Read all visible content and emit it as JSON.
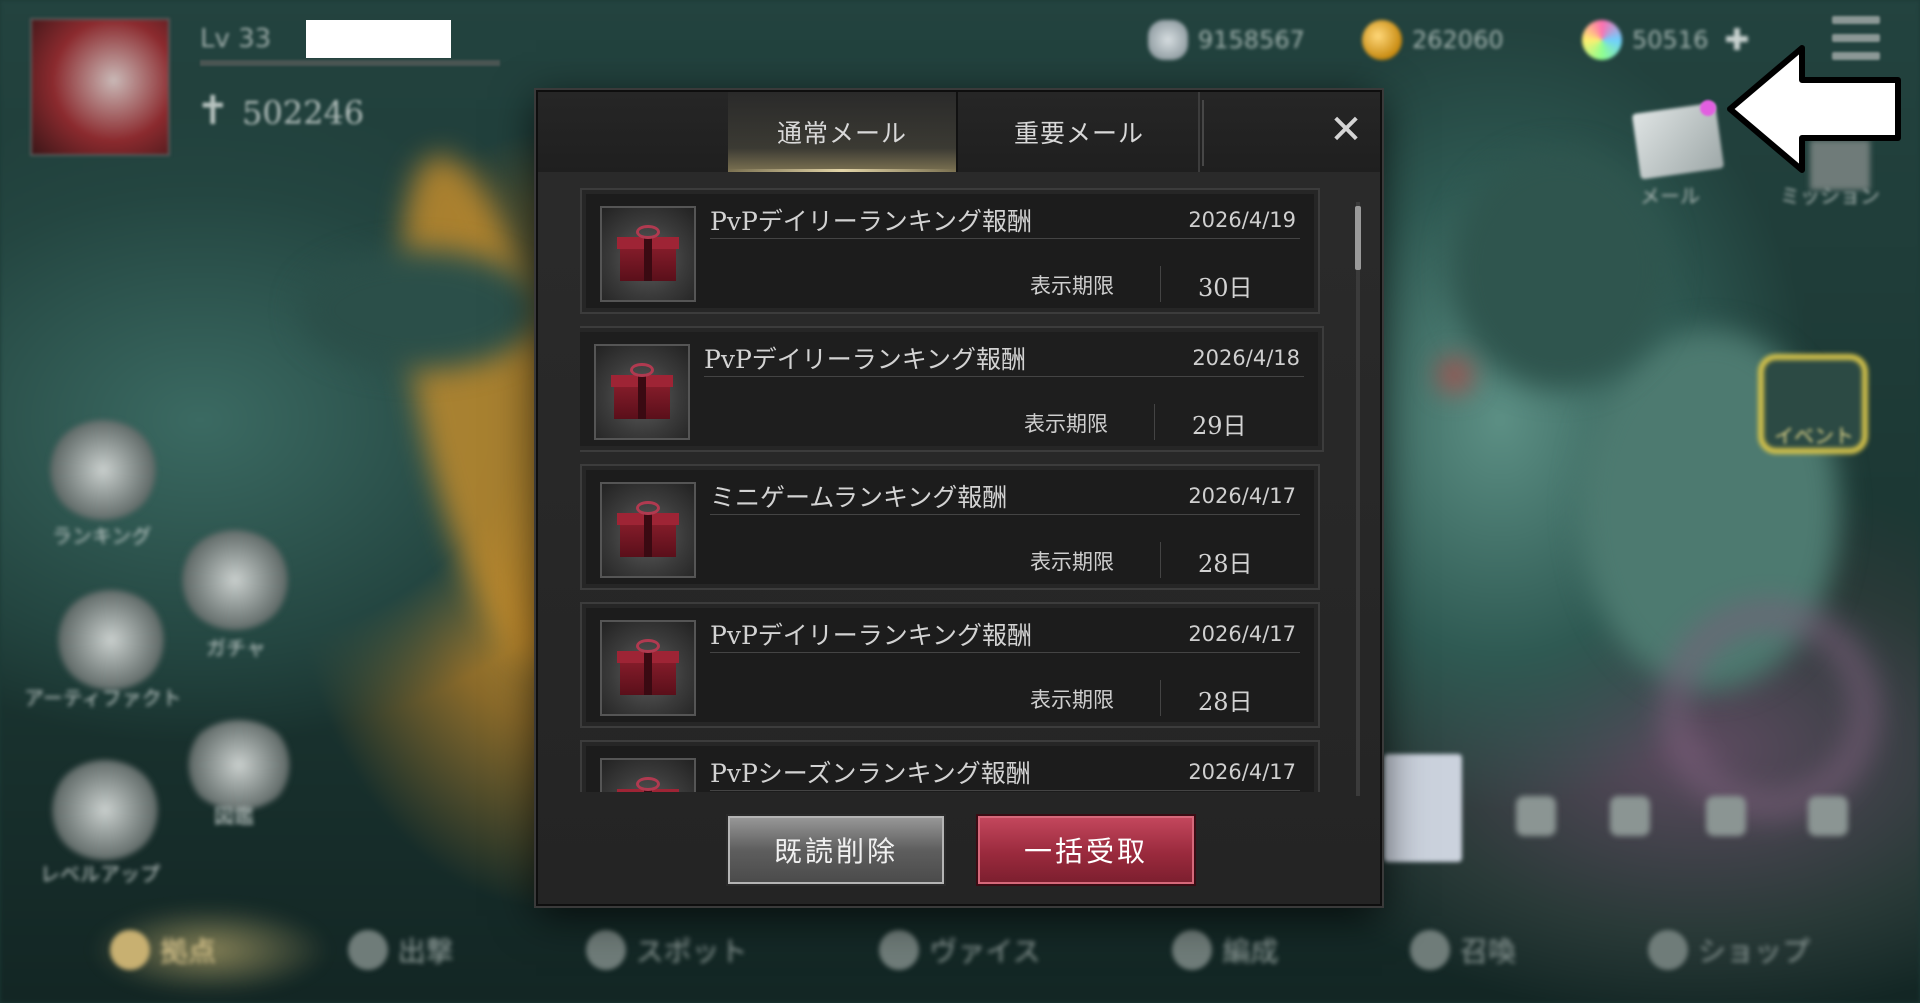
{
  "hud": {
    "level": "Lv 33",
    "power": "502246",
    "currencies": [
      {
        "name": "stone",
        "icon": "stone-icon",
        "value": "9158567"
      },
      {
        "name": "gold",
        "icon": "gold-coin-icon",
        "value": "262060"
      },
      {
        "name": "gem",
        "icon": "gem-icon",
        "value": "50516"
      }
    ],
    "mail_label": "メール",
    "mission_label": "ミッション"
  },
  "side_menu": [
    {
      "label": "ランキング"
    },
    {
      "label": "ガチャ"
    },
    {
      "label": "アーティファクト"
    },
    {
      "label": "図鑑"
    },
    {
      "label": "レベルアップ"
    }
  ],
  "event_badge": {
    "label": "イベント"
  },
  "bottom_nav": [
    {
      "label": "拠点",
      "active": true
    },
    {
      "label": "出撃",
      "active": false
    },
    {
      "label": "スポット",
      "active": false
    },
    {
      "label": "ヴァイス",
      "active": false
    },
    {
      "label": "編成",
      "active": false
    },
    {
      "label": "召喚",
      "active": false
    },
    {
      "label": "ショップ",
      "active": false
    }
  ],
  "dialog": {
    "tabs": [
      {
        "label": "通常メール",
        "selected": true
      },
      {
        "label": "重要メール",
        "selected": false
      }
    ],
    "close_label": "✕",
    "period_label": "表示期限",
    "mails": [
      {
        "title": "PvPデイリーランキング報酬",
        "date": "2026/4/19",
        "period": "30日"
      },
      {
        "title": "PvPデイリーランキング報酬",
        "date": "2026/4/18",
        "period": "29日"
      },
      {
        "title": "ミニゲームランキング報酬",
        "date": "2026/4/17",
        "period": "28日"
      },
      {
        "title": "PvPデイリーランキング報酬",
        "date": "2026/4/17",
        "period": "28日"
      },
      {
        "title": "PvPシーズンランキング報酬",
        "date": "2026/4/17",
        "period": ""
      }
    ],
    "buttons": {
      "delete_read": "既読削除",
      "claim_all": "一括受取"
    }
  }
}
